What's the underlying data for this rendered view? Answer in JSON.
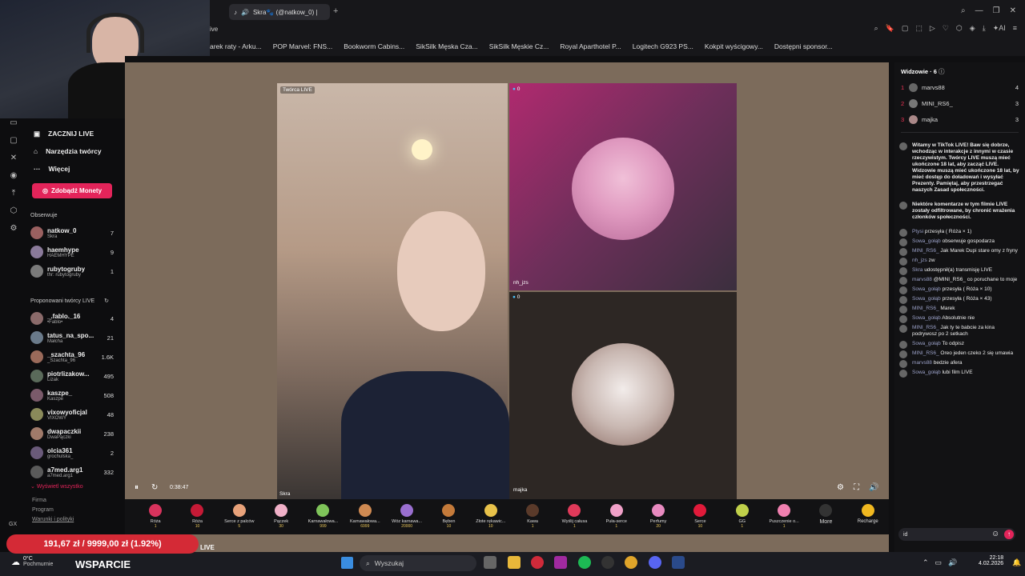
{
  "browser": {
    "tab_title": "Skra🐾 (@natkow_0) |",
    "partial_url": "ive",
    "bookmarks": [
      "arek raty - Arku...",
      "POP Marvel: FNS...",
      "Bookworm Cabins...",
      "SikSilk Męska Cza...",
      "SikSilk Męskie Cz...",
      "Royal Aparthotel P...",
      "Logitech G923 PS...",
      "Kokpit wyścigowy...",
      "Dostępni sponsor..."
    ]
  },
  "sidebar": {
    "nav": [
      "ZACZNIJ LIVE",
      "Narzędzia twórcy",
      "Więcej"
    ],
    "coins_button": "Zdobądź Monety",
    "follow_title": "Obserwuje",
    "follow": [
      {
        "name": "natkow_0",
        "sub": "Skra",
        "count": "7"
      },
      {
        "name": "haemhype",
        "sub": "HAEMHYPE",
        "count": "9"
      },
      {
        "name": "rubytogruby",
        "sub": "thr: rubytogruby",
        "count": "1"
      }
    ],
    "suggested_title": "Proponowani twórcy LIVE",
    "suggested": [
      {
        "name": "_.fablo._16",
        "sub": "•Fablo•",
        "count": "4"
      },
      {
        "name": "tatus_na_spo...",
        "sub": "Małcha",
        "count": "21"
      },
      {
        "name": "_szachta_96",
        "sub": "_Szachta_96",
        "count": "1.6K"
      },
      {
        "name": "piotrlizakow...",
        "sub": "Lizak",
        "count": "495"
      },
      {
        "name": "kaszpe_",
        "sub": "Kaszpe",
        "count": "508"
      },
      {
        "name": "vixowyoficjal",
        "sub": "VIXOWY",
        "count": "48"
      },
      {
        "name": "dwapaczkii",
        "sub": "DwaPączki",
        "count": "238"
      },
      {
        "name": "olcia361",
        "sub": "grochulska_",
        "count": "2"
      },
      {
        "name": "a7med.arg1",
        "sub": "a7med.arg1",
        "count": "332"
      }
    ],
    "show_all": "Wyświetl wszystko",
    "footer": [
      "Firma",
      "Program",
      "Warunki i polityki"
    ]
  },
  "stream": {
    "creator_badge": "Twórca LIVE",
    "host_name": "Skra",
    "guest1": "nh_jzs",
    "guest2": "majka",
    "guest_viewers1": "0",
    "guest_viewers2": "0",
    "time": "0:38:47"
  },
  "gifts": [
    {
      "name": "Róża",
      "cost": "1",
      "color": "#d8335d"
    },
    {
      "name": "Róża",
      "cost": "10",
      "color": "#c51a36"
    },
    {
      "name": "Serce z palców",
      "cost": "5",
      "color": "#e8a27a"
    },
    {
      "name": "Pączek",
      "cost": "30",
      "color": "#f0b0c8"
    },
    {
      "name": "Karnawałowa...",
      "cost": "999",
      "color": "#7fc45a"
    },
    {
      "name": "Karnawałowa...",
      "cost": "6999",
      "color": "#d08a52"
    },
    {
      "name": "Wóz karnawa...",
      "cost": "20000",
      "color": "#9a6fd0"
    },
    {
      "name": "Bęben",
      "cost": "10",
      "color": "#c47a3a"
    },
    {
      "name": "Złote rękawic...",
      "cost": "10",
      "color": "#e8c24a"
    },
    {
      "name": "Kawa",
      "cost": "1",
      "color": "#5a3a2a"
    },
    {
      "name": "Wyślij całusa",
      "cost": "1",
      "color": "#e03a5a"
    },
    {
      "name": "Puła-serce",
      "cost": "1",
      "color": "#f0a0c8"
    },
    {
      "name": "Perfumy",
      "cost": "20",
      "color": "#e88ac0"
    },
    {
      "name": "Serce",
      "cost": "10",
      "color": "#e01a3a"
    },
    {
      "name": "GG",
      "cost": "1",
      "color": "#c0d04a"
    },
    {
      "name": "Puszczenie o...",
      "cost": "1",
      "color": "#f080b0"
    }
  ],
  "gift_more": "More",
  "recharge": "Recharge",
  "chat": {
    "viewers_title": "Widzowie · 6",
    "viewers": [
      {
        "rank": "1",
        "name": "marvs88",
        "count": "4"
      },
      {
        "rank": "2",
        "name": "MINI_RS6_",
        "count": "3"
      },
      {
        "rank": "3",
        "name": "majka",
        "count": "3"
      }
    ],
    "messages": [
      {
        "who": "",
        "text": "Witamy w TikTok LIVE! Baw się dobrze, wchodząc w interakcje z innymi w czasie rzeczywistym. Twórcy LIVE muszą mieć ukończone 18 lat, aby zacząć LIVE. Widzowie muszą mieć ukończone 18 lat, by mieć dostęp do doładowań i wysyłać Prezenty. Pamiętaj, aby przestrzegać naszych Zasad społeczności."
      },
      {
        "who": "",
        "text": "Niektóre komentarze w tym filmie LIVE zostały odfiltrowane, by chronić wrażenia członków społeczności."
      },
      {
        "who": "Ptysi",
        "text": "przesyła ( Róża × 1)"
      },
      {
        "who": "Sowa_gołąb",
        "text": "obserwuje gospodarza"
      },
      {
        "who": "MINI_RS6_",
        "text": "Jak Marek Dupi stare omy z fryny"
      },
      {
        "who": "nh_jzs",
        "text": "zw"
      },
      {
        "who": "Skra",
        "text": "udostępnił(a) transmisję LIVE"
      },
      {
        "who": "marvs88",
        "text": "@MINI_RS6_ co poruchane to moje"
      },
      {
        "who": "Sowa_gołąb",
        "text": "przesyła ( Róża × 10)"
      },
      {
        "who": "Sowa_gołąb",
        "text": "przesyła ( Róża × 43)"
      },
      {
        "who": "MINI_RS6_",
        "text": "Marek"
      },
      {
        "who": "Sowa_gołąb",
        "text": "Absolutnie nie"
      },
      {
        "who": "MINI_RS6_",
        "text": "Jak ty te babcie za kina podrywosz po 2 setkach"
      },
      {
        "who": "Sowa_gołąb",
        "text": "To odpisz"
      },
      {
        "who": "MINI_RS6_",
        "text": "Oreo jeden czeko 2 się umawia"
      },
      {
        "who": "marvs88",
        "text": "bedzie afera"
      },
      {
        "who": "Sowa_gołąb",
        "text": "lubi film LIVE"
      }
    ],
    "input_value": "id"
  },
  "overlay": {
    "donation": "191,67 zł / 9999,00 zł (1.92%)",
    "support": "WSPARCIE",
    "live_label": "LIVE"
  },
  "taskbar": {
    "weather_temp": "0°C",
    "weather_desc": "Pochmurnie",
    "search": "Wyszukaj",
    "time": "22:18",
    "date": "4.02.2026"
  }
}
